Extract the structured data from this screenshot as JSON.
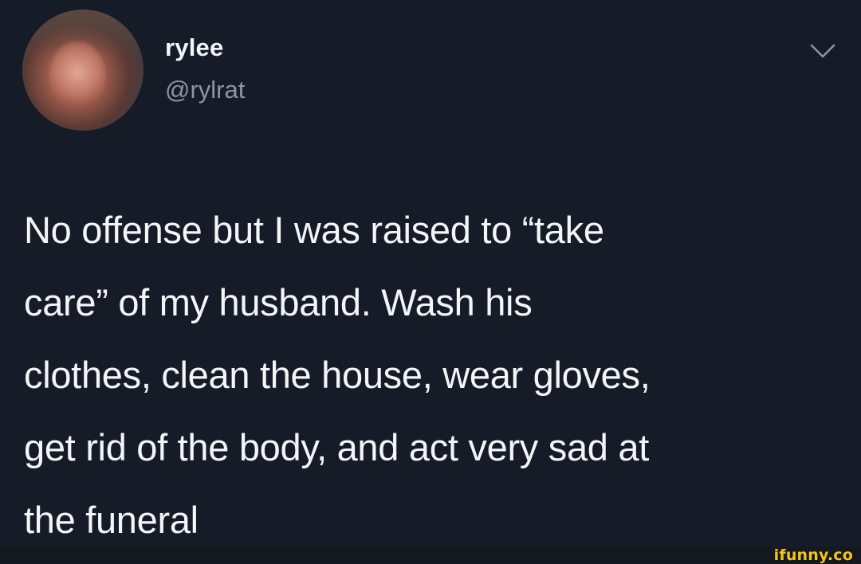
{
  "tweet": {
    "display_name": "rylee",
    "handle": "@rylrat",
    "text": "No offense but I was raised to “take\ncare” of my husband. Wash his\nclothes, clean the house, wear gloves,\nget rid of the body, and act very sad at\nthe funeral",
    "menu_icon": "chevron-down-icon",
    "avatar_icon": "avatar"
  },
  "watermark": {
    "text": "ifunny.co"
  },
  "colors": {
    "background": "#161b28",
    "text": "#f4f5f7",
    "handle": "#8d96a5",
    "watermark": "#f5c518"
  }
}
